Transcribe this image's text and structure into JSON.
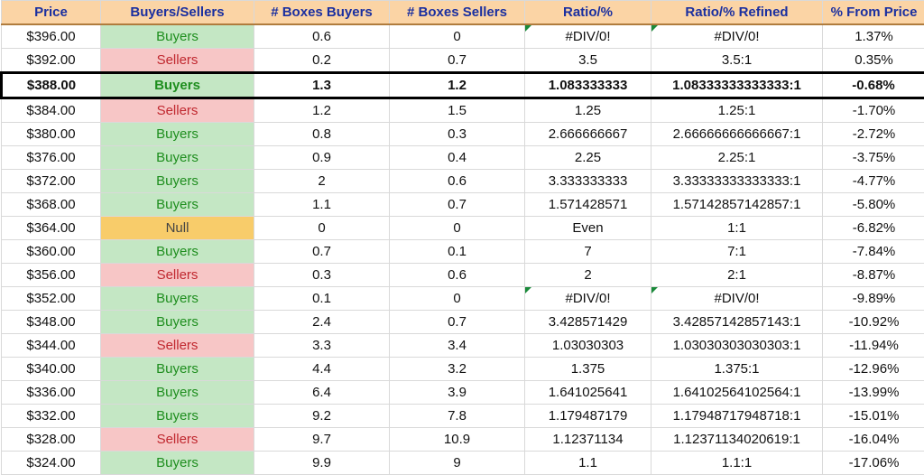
{
  "headers": {
    "price": "Price",
    "bs": "Buyers/Sellers",
    "boxes_buyers": "# Boxes Buyers",
    "boxes_sellers": "# Boxes Sellers",
    "ratio": "Ratio/%",
    "ratio_refined": "Ratio/% Refined",
    "pct_from": "% From Price"
  },
  "rows": [
    {
      "price": "$396.00",
      "bs": "Buyers",
      "bb": "0.6",
      "bsell": "0",
      "ratio": "#DIV/0!",
      "refined": "#DIV/0!",
      "pct": "1.37%",
      "err": true,
      "hilite": false
    },
    {
      "price": "$392.00",
      "bs": "Sellers",
      "bb": "0.2",
      "bsell": "0.7",
      "ratio": "3.5",
      "refined": "3.5:1",
      "pct": "0.35%",
      "err": false,
      "hilite": false
    },
    {
      "price": "$388.00",
      "bs": "Buyers",
      "bb": "1.3",
      "bsell": "1.2",
      "ratio": "1.083333333",
      "refined": "1.08333333333333:1",
      "pct": "-0.68%",
      "err": false,
      "hilite": true
    },
    {
      "price": "$384.00",
      "bs": "Sellers",
      "bb": "1.2",
      "bsell": "1.5",
      "ratio": "1.25",
      "refined": "1.25:1",
      "pct": "-1.70%",
      "err": false,
      "hilite": false
    },
    {
      "price": "$380.00",
      "bs": "Buyers",
      "bb": "0.8",
      "bsell": "0.3",
      "ratio": "2.666666667",
      "refined": "2.66666666666667:1",
      "pct": "-2.72%",
      "err": false,
      "hilite": false
    },
    {
      "price": "$376.00",
      "bs": "Buyers",
      "bb": "0.9",
      "bsell": "0.4",
      "ratio": "2.25",
      "refined": "2.25:1",
      "pct": "-3.75%",
      "err": false,
      "hilite": false
    },
    {
      "price": "$372.00",
      "bs": "Buyers",
      "bb": "2",
      "bsell": "0.6",
      "ratio": "3.333333333",
      "refined": "3.33333333333333:1",
      "pct": "-4.77%",
      "err": false,
      "hilite": false
    },
    {
      "price": "$368.00",
      "bs": "Buyers",
      "bb": "1.1",
      "bsell": "0.7",
      "ratio": "1.571428571",
      "refined": "1.57142857142857:1",
      "pct": "-5.80%",
      "err": false,
      "hilite": false
    },
    {
      "price": "$364.00",
      "bs": "Null",
      "bb": "0",
      "bsell": "0",
      "ratio": "Even",
      "refined": "1:1",
      "pct": "-6.82%",
      "err": false,
      "hilite": false
    },
    {
      "price": "$360.00",
      "bs": "Buyers",
      "bb": "0.7",
      "bsell": "0.1",
      "ratio": "7",
      "refined": "7:1",
      "pct": "-7.84%",
      "err": false,
      "hilite": false
    },
    {
      "price": "$356.00",
      "bs": "Sellers",
      "bb": "0.3",
      "bsell": "0.6",
      "ratio": "2",
      "refined": "2:1",
      "pct": "-8.87%",
      "err": false,
      "hilite": false
    },
    {
      "price": "$352.00",
      "bs": "Buyers",
      "bb": "0.1",
      "bsell": "0",
      "ratio": "#DIV/0!",
      "refined": "#DIV/0!",
      "pct": "-9.89%",
      "err": true,
      "hilite": false
    },
    {
      "price": "$348.00",
      "bs": "Buyers",
      "bb": "2.4",
      "bsell": "0.7",
      "ratio": "3.428571429",
      "refined": "3.42857142857143:1",
      "pct": "-10.92%",
      "err": false,
      "hilite": false
    },
    {
      "price": "$344.00",
      "bs": "Sellers",
      "bb": "3.3",
      "bsell": "3.4",
      "ratio": "1.03030303",
      "refined": "1.03030303030303:1",
      "pct": "-11.94%",
      "err": false,
      "hilite": false
    },
    {
      "price": "$340.00",
      "bs": "Buyers",
      "bb": "4.4",
      "bsell": "3.2",
      "ratio": "1.375",
      "refined": "1.375:1",
      "pct": "-12.96%",
      "err": false,
      "hilite": false
    },
    {
      "price": "$336.00",
      "bs": "Buyers",
      "bb": "6.4",
      "bsell": "3.9",
      "ratio": "1.641025641",
      "refined": "1.64102564102564:1",
      "pct": "-13.99%",
      "err": false,
      "hilite": false
    },
    {
      "price": "$332.00",
      "bs": "Buyers",
      "bb": "9.2",
      "bsell": "7.8",
      "ratio": "1.179487179",
      "refined": "1.17948717948718:1",
      "pct": "-15.01%",
      "err": false,
      "hilite": false
    },
    {
      "price": "$328.00",
      "bs": "Sellers",
      "bb": "9.7",
      "bsell": "10.9",
      "ratio": "1.12371134",
      "refined": "1.12371134020619:1",
      "pct": "-16.04%",
      "err": false,
      "hilite": false
    },
    {
      "price": "$324.00",
      "bs": "Buyers",
      "bb": "9.9",
      "bsell": "9",
      "ratio": "1.1",
      "refined": "1.1:1",
      "pct": "-17.06%",
      "err": false,
      "hilite": false
    }
  ]
}
